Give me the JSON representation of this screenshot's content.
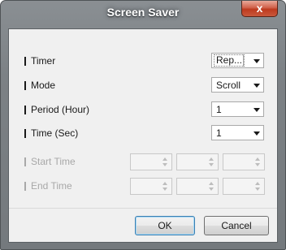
{
  "window": {
    "title": "Screen Saver",
    "close_glyph": "x"
  },
  "rows": {
    "timer": {
      "label": "Timer",
      "value": "Rep..."
    },
    "mode": {
      "label": "Mode",
      "value": "Scroll"
    },
    "period": {
      "label": "Period (Hour)",
      "value": "1"
    },
    "time": {
      "label": "Time (Sec)",
      "value": "1"
    },
    "start_time": {
      "label": "Start Time"
    },
    "end_time": {
      "label": "End Time"
    }
  },
  "buttons": {
    "ok": "OK",
    "cancel": "Cancel"
  },
  "colors": {
    "titlebar": "#7c8185",
    "close_button": "#c9583c",
    "dialog_body": "#f0f0f0",
    "disabled_text": "#a8a8a8"
  }
}
